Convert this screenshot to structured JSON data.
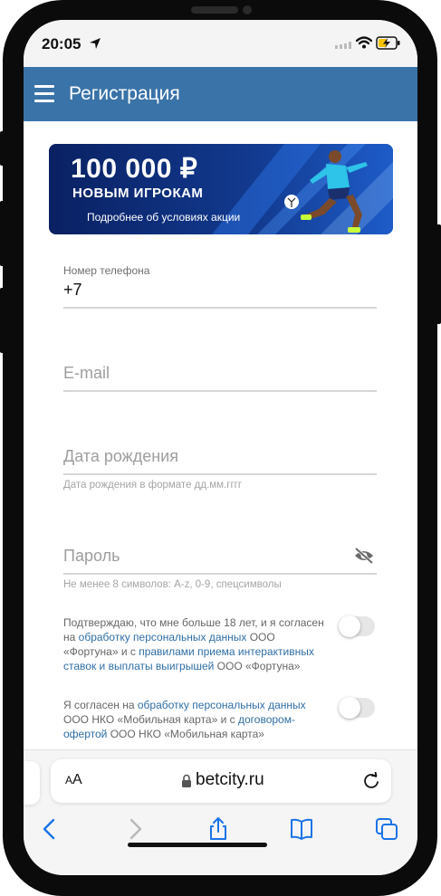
{
  "status_bar": {
    "time": "20:05"
  },
  "header": {
    "title": "Регистрация"
  },
  "banner": {
    "amount": "100 000 ₽",
    "subtitle": "НОВЫМ ИГРОКАМ",
    "link": "Подробнее об условиях акции"
  },
  "form": {
    "phone": {
      "label": "Номер телефона",
      "value": "+7"
    },
    "email": {
      "placeholder": "E-mail"
    },
    "birthdate": {
      "placeholder": "Дата рождения",
      "hint": "Дата рождения в формате дд.мм.гггг"
    },
    "password": {
      "placeholder": "Пароль",
      "hint": "Не менее 8 символов: A-z, 0-9, спецсимволы"
    }
  },
  "consents": [
    {
      "text_1": "Подтверждаю, что мне больше 18 лет, и я согласен на ",
      "link_1": "обработку персональных данных",
      "text_2": " ООО «Фортуна» и с ",
      "link_2": "правилами приема интерактивных ставок и выплаты выигрышей",
      "text_3": " ООО «Фортуна»",
      "enabled": false
    },
    {
      "text_1": "Я согласен на ",
      "link_1": "обработку персональных данных",
      "text_2": " ООО НКО «Мобильная карта» и с ",
      "link_2": "договором-офертой",
      "text_3": " ООО НКО «Мобильная карта»",
      "enabled": false
    }
  ],
  "browser": {
    "aa_small": "A",
    "aa_large": "A",
    "url": "betcity.ru"
  },
  "colors": {
    "header": "#3a73a8",
    "link": "#2f6ea5",
    "banner": "#0d2a6e"
  }
}
